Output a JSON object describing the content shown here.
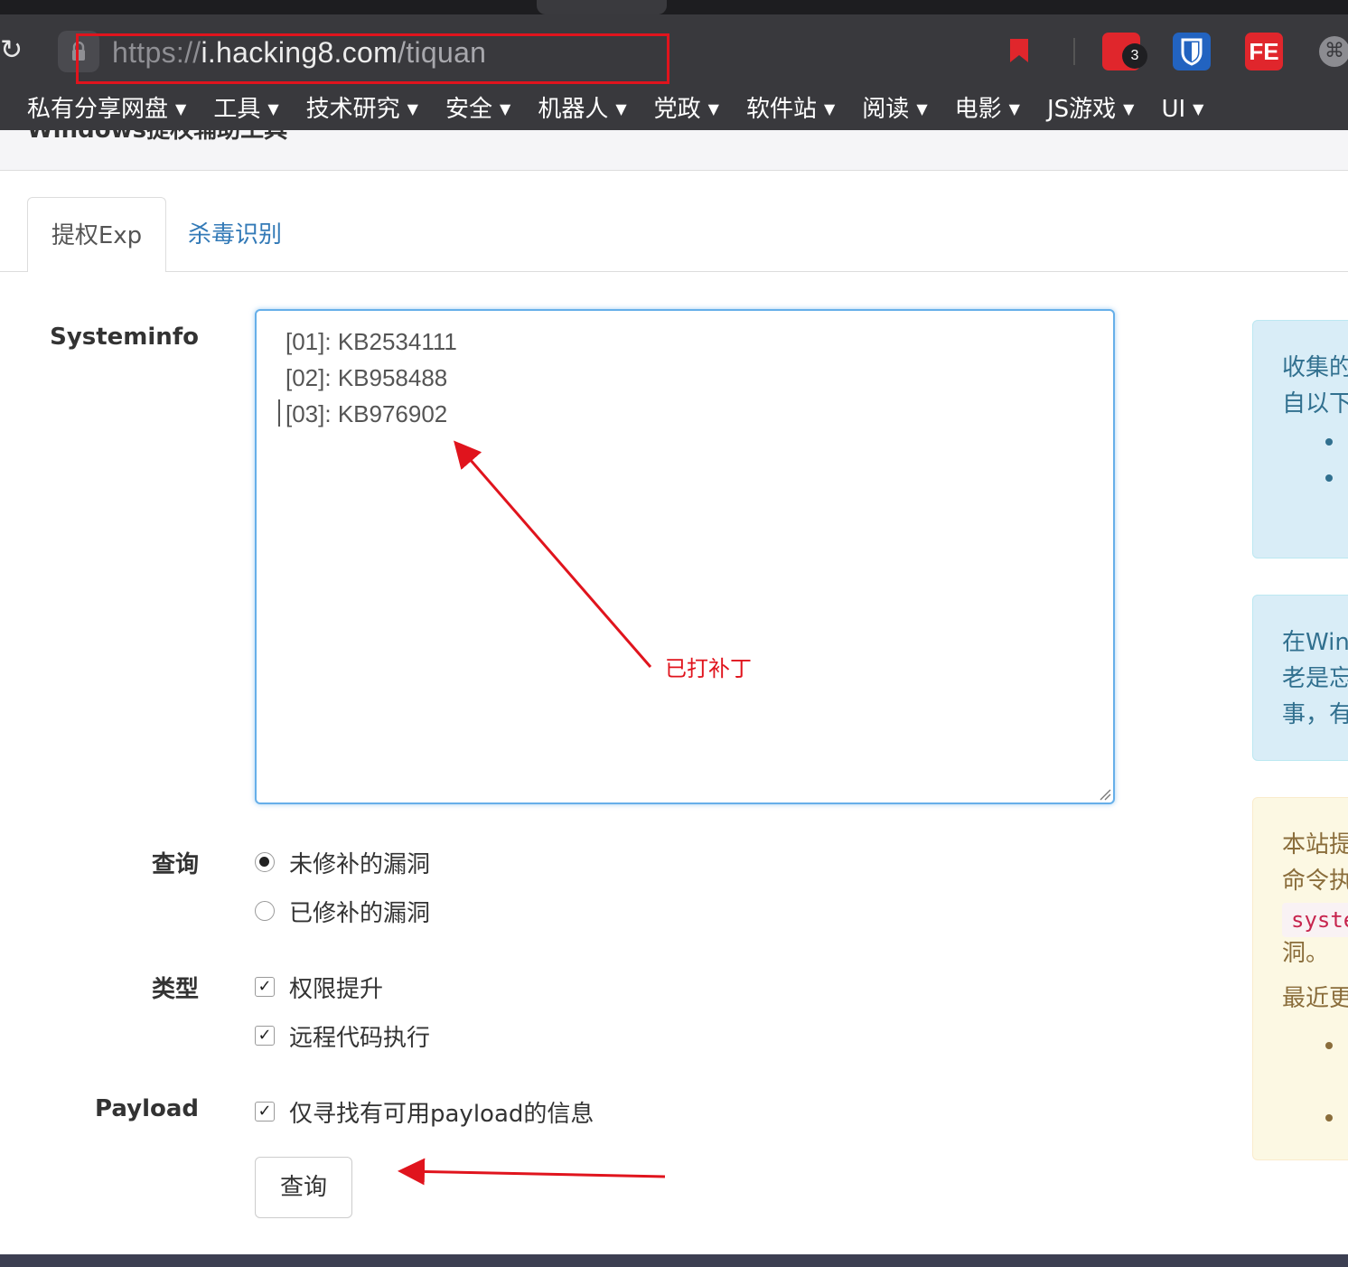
{
  "browser": {
    "url_scheme": "https://",
    "url_host": "i.hacking8.com",
    "url_path": "/tiquan",
    "extension_badge": "3",
    "fe_label": "FE",
    "bookmarks": [
      {
        "label": "私有分享网盘"
      },
      {
        "label": "工具"
      },
      {
        "label": "技术研究"
      },
      {
        "label": "安全"
      },
      {
        "label": "机器人"
      },
      {
        "label": "党政"
      },
      {
        "label": "软件站"
      },
      {
        "label": "阅读"
      },
      {
        "label": "电影"
      },
      {
        "label": "JS游戏"
      },
      {
        "label": "UI"
      }
    ]
  },
  "page": {
    "title": "Windows提权辅助工具",
    "tabs": [
      {
        "label": "提权Exp",
        "active": true
      },
      {
        "label": "杀毒识别",
        "active": false
      }
    ],
    "form": {
      "systeminfo_label": "Systeminfo",
      "systeminfo_lines": [
        "[01]: KB2534111",
        "[02]: KB958488",
        "[03]: KB976902"
      ],
      "query_label": "查询",
      "query_options": [
        {
          "label": "未修补的漏洞",
          "selected": true
        },
        {
          "label": "已修补的漏洞",
          "selected": false
        }
      ],
      "type_label": "类型",
      "type_options": [
        {
          "label": "权限提升",
          "checked": true
        },
        {
          "label": "远程代码执行",
          "checked": true
        }
      ],
      "payload_label": "Payload",
      "payload_option": {
        "label": "仅寻找有可用payload的信息",
        "checked": true
      },
      "submit_label": "查询"
    },
    "sidebar": {
      "info1_lines": [
        "收集的",
        "自以下"
      ],
      "info2_lines": [
        "在Win",
        "老是忘",
        "事，有"
      ],
      "warn_lines": [
        "本站提",
        "命令执"
      ],
      "warn_code": "syste",
      "warn_after": "洞。",
      "warn_recent": "最近更"
    }
  },
  "annotation": {
    "note": "已打补丁",
    "color": "#e0141d"
  }
}
